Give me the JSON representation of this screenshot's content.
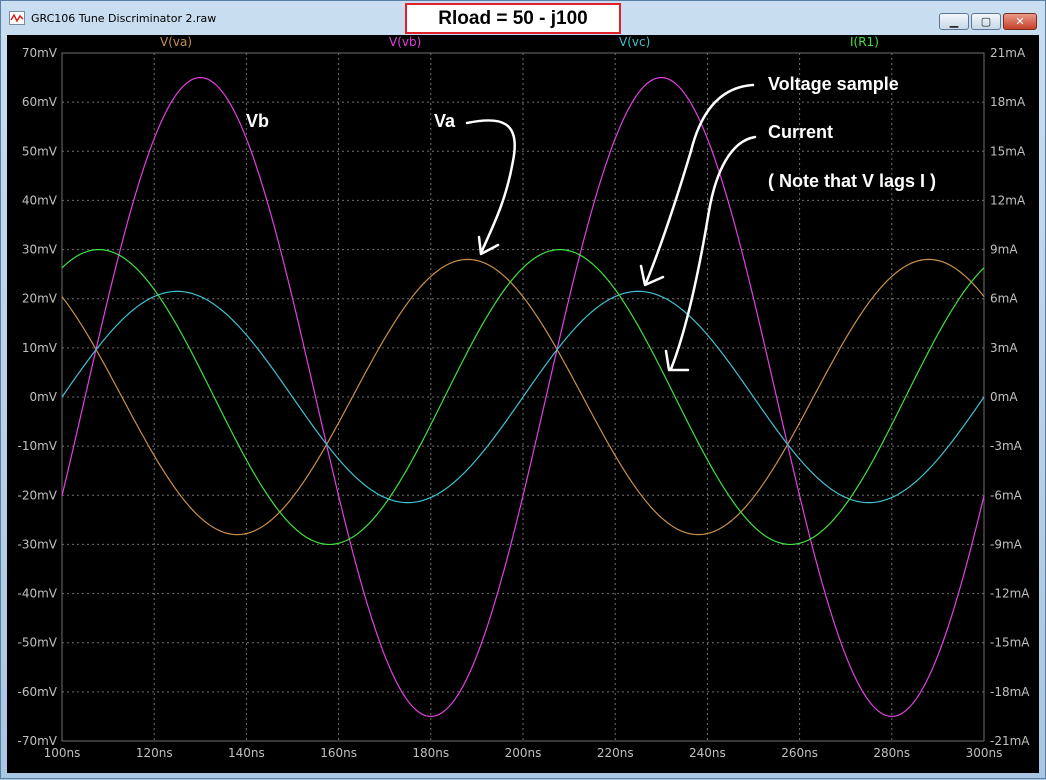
{
  "window": {
    "app_title": "GRC106 Tune Discriminator 2.raw",
    "center_title": "Rload = 50 - j100",
    "controls": {
      "minimize": "▁",
      "maximize": "▢",
      "close": "✕"
    }
  },
  "colors": {
    "va": "#c8904a",
    "vb": "#e040e0",
    "vc": "#40c0d0",
    "ir1": "#40e040",
    "axis_text": "#c0c0c0",
    "grid": "#707070"
  },
  "legend": {
    "va": "V(va)",
    "vb": "V(vb)",
    "vc": "V(vc)",
    "ir1": "I(R1)"
  },
  "annotations": {
    "vb_label": "Vb",
    "va_label": "Va",
    "voltage_sample": "Voltage sample",
    "current": "Current",
    "note": "( Note that  V lags I )"
  },
  "chart_data": {
    "type": "line",
    "x_unit": "ns",
    "x_range": [
      100,
      300
    ],
    "y_left_range": [
      -70,
      70
    ],
    "y_left_unit": "mV",
    "y_right_range": [
      -21,
      21
    ],
    "y_right_unit": "mA",
    "x_ticks": [
      "100ns",
      "120ns",
      "140ns",
      "160ns",
      "180ns",
      "200ns",
      "220ns",
      "240ns",
      "260ns",
      "280ns",
      "300ns"
    ],
    "y_left_ticks": [
      "70mV",
      "60mV",
      "50mV",
      "40mV",
      "30mV",
      "20mV",
      "10mV",
      "0mV",
      "-10mV",
      "-20mV",
      "-30mV",
      "-40mV",
      "-50mV",
      "-60mV",
      "-70mV"
    ],
    "y_right_ticks": [
      "21mA",
      "18mA",
      "15mA",
      "12mA",
      "9mA",
      "6mA",
      "3mA",
      "0mA",
      "-3mA",
      "-6mA",
      "-9mA",
      "-12mA",
      "-15mA",
      "-18mA",
      "-21mA"
    ],
    "grid": true,
    "period_ns": 100,
    "series": [
      {
        "name": "V(va)",
        "axis": "left",
        "amplitude": 28,
        "peak_at": 188,
        "unit": "mV"
      },
      {
        "name": "V(vb)",
        "axis": "left",
        "amplitude": 65,
        "peak_at": 130,
        "unit": "mV"
      },
      {
        "name": "V(vc)",
        "axis": "left",
        "amplitude": 21.5,
        "peak_at": 125,
        "unit": "mV"
      },
      {
        "name": "I(R1)",
        "axis": "right",
        "amplitude": 9,
        "peak_at": 108,
        "unit": "mA"
      }
    ]
  }
}
